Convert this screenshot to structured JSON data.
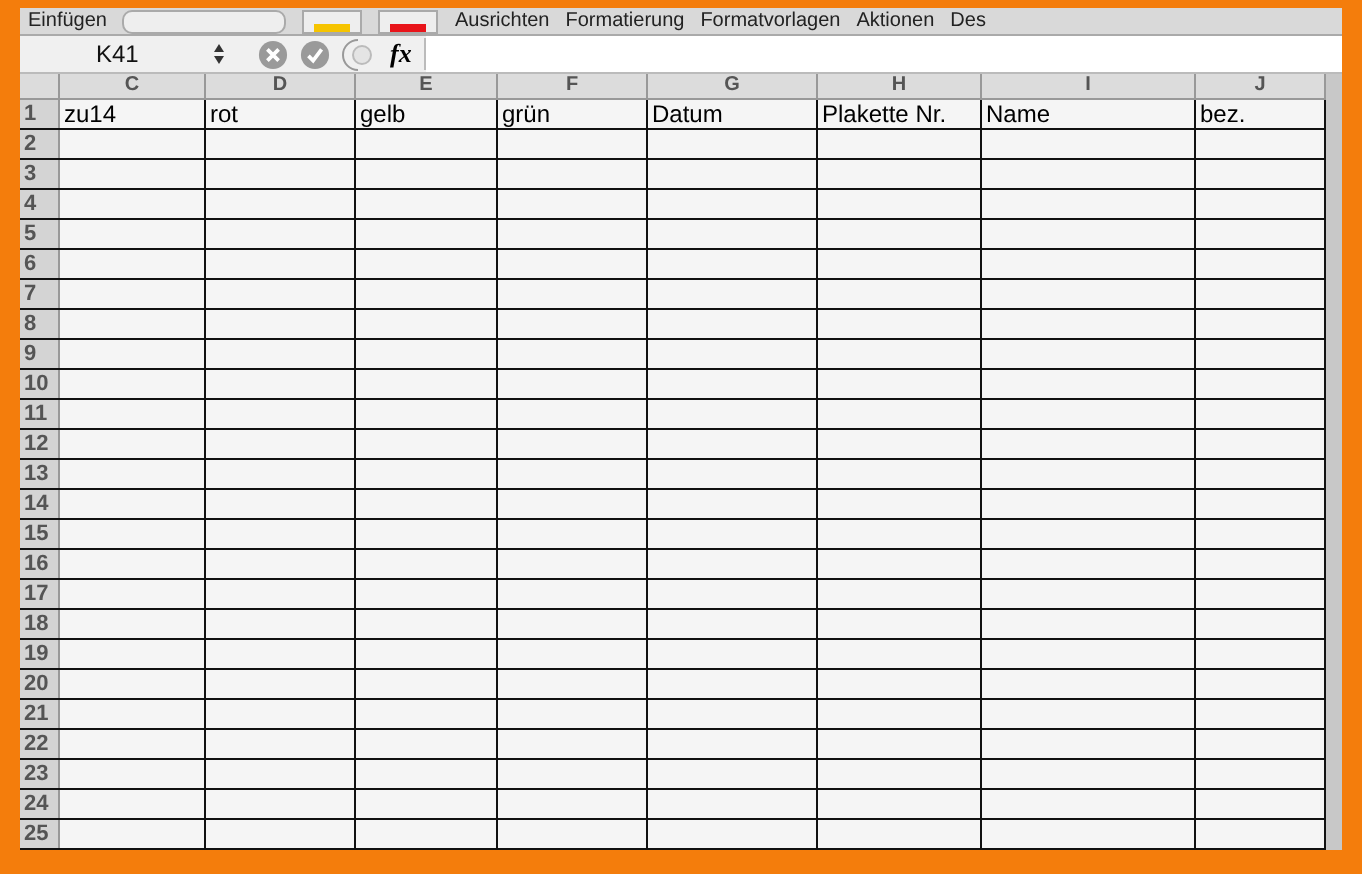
{
  "toolbar": {
    "items": [
      {
        "label": "Einfügen"
      },
      {
        "label": "Ausrichten"
      },
      {
        "label": "Formatierung"
      },
      {
        "label": "Formatvorlagen"
      },
      {
        "label": "Aktionen"
      },
      {
        "label": "Des"
      }
    ]
  },
  "formula_bar": {
    "name_box": "K41",
    "function_label": "fx"
  },
  "sheet": {
    "columns": [
      "C",
      "D",
      "E",
      "F",
      "G",
      "H",
      "I",
      "J"
    ],
    "rows": [
      {
        "number": "1",
        "cells": [
          "zu14",
          "rot",
          "gelb",
          "grün",
          "Datum",
          "Plakette Nr.",
          "Name",
          "bez."
        ]
      },
      {
        "number": "2"
      },
      {
        "number": "3"
      },
      {
        "number": "4"
      },
      {
        "number": "5"
      },
      {
        "number": "6"
      },
      {
        "number": "7"
      },
      {
        "number": "8"
      },
      {
        "number": "9"
      },
      {
        "number": "10"
      },
      {
        "number": "11"
      },
      {
        "number": "12"
      },
      {
        "number": "13"
      },
      {
        "number": "14"
      },
      {
        "number": "15"
      },
      {
        "number": "16"
      },
      {
        "number": "17"
      },
      {
        "number": "18"
      },
      {
        "number": "19"
      },
      {
        "number": "20"
      },
      {
        "number": "21"
      },
      {
        "number": "22"
      },
      {
        "number": "23"
      },
      {
        "number": "24"
      },
      {
        "number": "25"
      }
    ]
  }
}
